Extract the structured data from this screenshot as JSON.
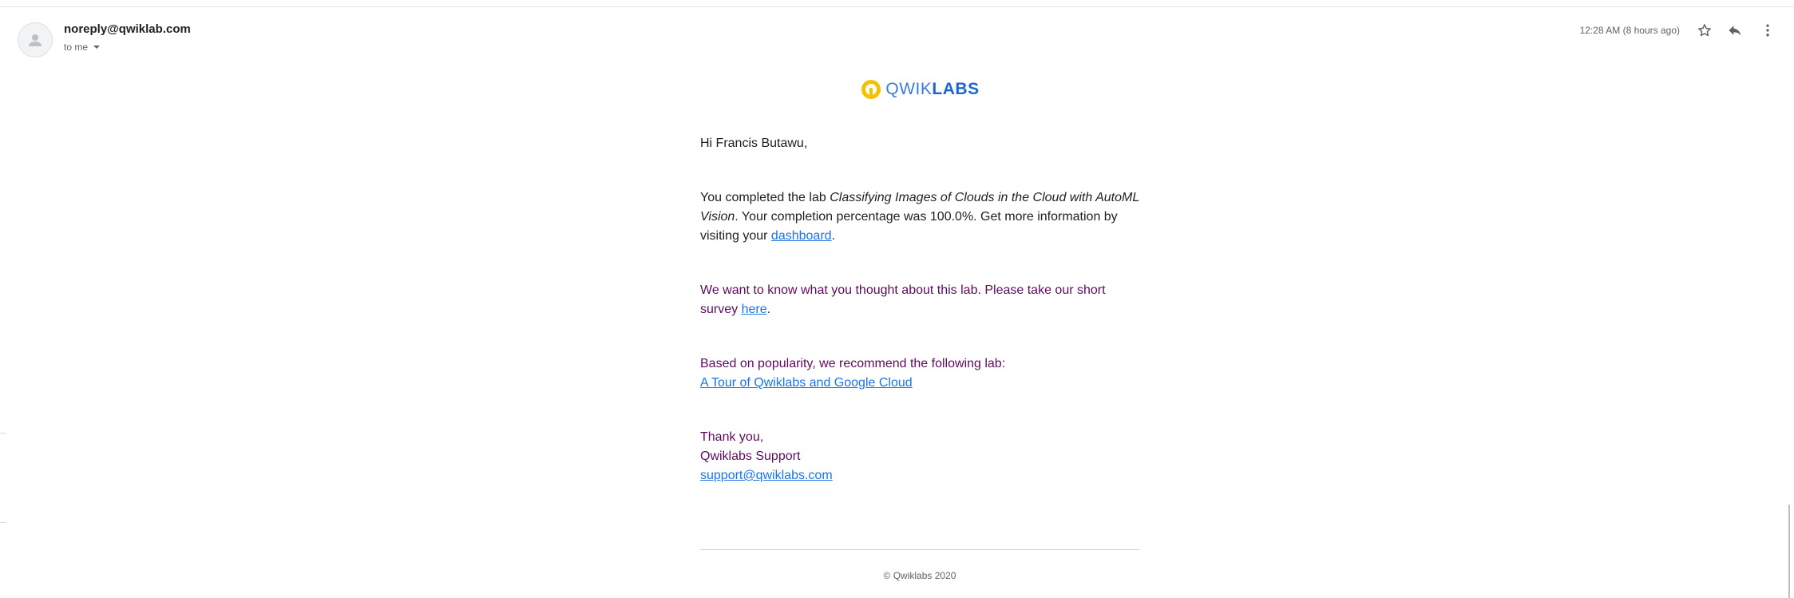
{
  "header": {
    "sender": "noreply@qwiklab.com",
    "recipient_label": "to me",
    "timestamp": "12:28 AM (8 hours ago)",
    "icons": {
      "avatar": "person-icon",
      "star": "star-icon",
      "reply": "reply-icon",
      "more": "more-vert-icon",
      "recipient_dropdown": "chevron-down-icon"
    }
  },
  "logo": {
    "light": "QWIK",
    "bold": "LABS"
  },
  "body": {
    "greeting": "Hi Francis Butawu,",
    "completion": {
      "prefix": "You completed the lab ",
      "lab_name": "Classifying Images of Clouds in the Cloud with AutoML Vision",
      "middle": ". Your completion percentage was 100.0%. Get more information by visiting your ",
      "link": "dashboard",
      "suffix": "."
    },
    "survey": {
      "prefix": "We want to know what you thought about this lab. Please take our short survey ",
      "link": "here",
      "suffix": "."
    },
    "recommendation": {
      "text": "Based on popularity, we recommend the following lab:",
      "link": "A Tour of Qwiklabs and Google Cloud"
    },
    "signoff": {
      "thanks": "Thank you,",
      "team": "Qwiklabs Support",
      "email": "support@qwiklabs.com"
    }
  },
  "footer": {
    "copyright": "© Qwiklabs 2020"
  },
  "colors": {
    "link": "#1a73e8",
    "purple_text": "#5c0b5c",
    "logo_yellow": "#f2c200",
    "logo_blue": "#1a66d6"
  }
}
